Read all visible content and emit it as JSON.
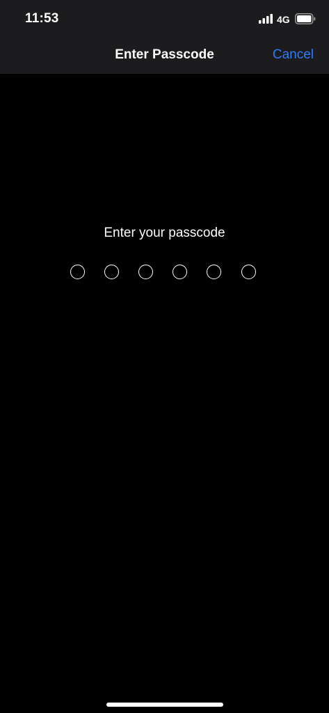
{
  "status_bar": {
    "time": "11:53",
    "network": "4G",
    "signal_icon": "cellular-signal-icon",
    "battery_icon": "battery-icon"
  },
  "nav": {
    "title": "Enter Passcode",
    "cancel_label": "Cancel"
  },
  "passcode": {
    "prompt": "Enter your passcode",
    "length": 6,
    "entered": 0
  },
  "colors": {
    "background": "#000000",
    "bar_background": "#1c1c1e",
    "accent": "#2f7cf6",
    "text": "#ffffff"
  }
}
